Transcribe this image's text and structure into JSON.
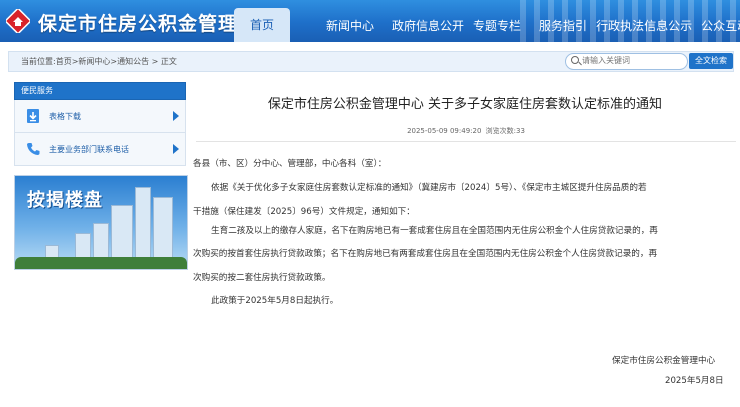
{
  "header": {
    "site_title": "保定市住房公积金管理中心",
    "home": "首页",
    "nav": [
      "新闻中心",
      "政府信息公开",
      "专题专栏",
      "服务指引",
      "行政执法信息公示",
      "公众互动"
    ]
  },
  "breadcrumb": {
    "prefix": "当前位置:",
    "items": [
      "首页",
      "新闻中心",
      "通知公告",
      "正文"
    ],
    "separator": ">"
  },
  "search": {
    "placeholder": "请输入关键词",
    "button": "全文检索"
  },
  "sidebar": {
    "header": "便民服务",
    "items": [
      {
        "label": "表格下载",
        "icon": "form-download-icon"
      },
      {
        "label": "主要业务部门联系电话",
        "icon": "phone-icon"
      }
    ],
    "banner_text": "按揭楼盘"
  },
  "article": {
    "title": "保定市住房公积金管理中心 关于多子女家庭住房套数认定标准的通知",
    "date": "2025-05-09 09:49:20",
    "views_label": "浏览次数:",
    "views": "33",
    "salutation": "各县（市、区）分中心、管理部，中心各科（室）：",
    "p1_line1": "依据《关于优化多子女家庭住房套数认定标准的通知》（冀建房市〔2024〕5号）、《保定市主城区提升住房品质的若",
    "p1_line2": "干措施（保住建发〔2025〕96号）文件规定，通知如下：",
    "p2_line1": "生育二孩及以上的缴存人家庭，名下在购房地已有一套成套住房且在全国范围内无住房公积金个人住房贷款记录的，再",
    "p2_line2": "次购买的按首套住房执行贷款政策；名下在购房地已有两套成套住房且在全国范围内无住房公积金个人住房贷款记录的，再",
    "p2_line3": "次购买的按二套住房执行贷款政策。",
    "p3": "此政策于2025年5月8日起执行。",
    "signature": "保定市住房公积金管理中心",
    "sign_date": "2025年5月8日"
  },
  "colors": {
    "header_blue": "#1e6fc9",
    "accent_blue": "#1f73c9",
    "logo_red": "#d8232a"
  }
}
